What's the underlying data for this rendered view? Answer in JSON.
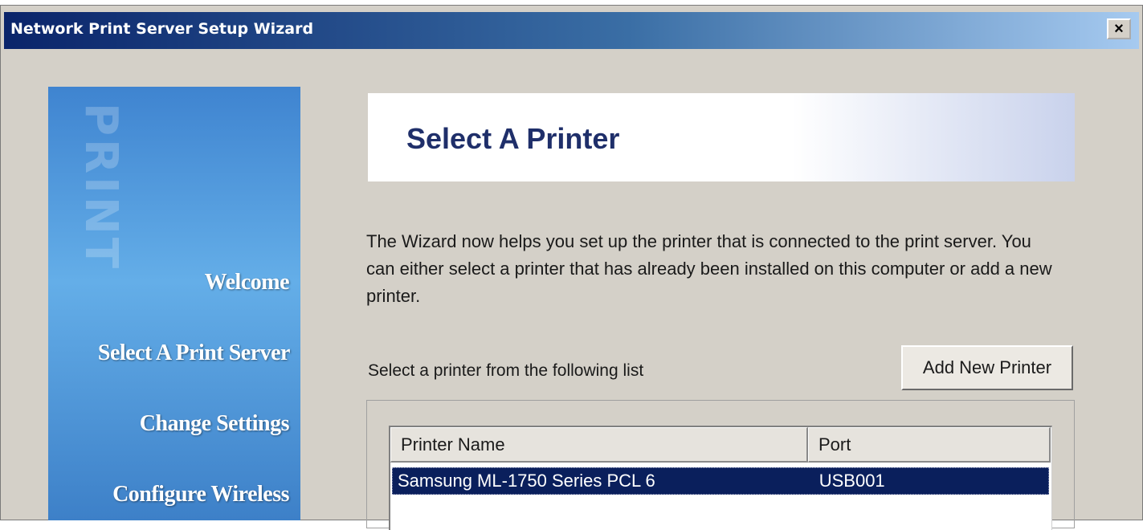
{
  "window": {
    "title": "Network Print Server Setup Wizard",
    "close_glyph": "×"
  },
  "sidebar": {
    "watermark": "PRINT",
    "items": [
      {
        "label": "Welcome"
      },
      {
        "label": "Select A Print Server"
      },
      {
        "label": "Change Settings"
      },
      {
        "label": "Configure Wireless"
      }
    ]
  },
  "header": {
    "title": "Select A Printer"
  },
  "main": {
    "description": "The Wizard now helps you set up the printer that is connected to the print server. You can either select a printer that has already been installed on this computer or add a new printer.",
    "list_label": "Select a printer from the following list",
    "add_button": "Add New Printer",
    "columns": [
      "Printer Name",
      "Port"
    ],
    "rows": [
      {
        "name": "Samsung ML-1750 Series PCL 6",
        "port": "USB001",
        "selected": true
      }
    ]
  },
  "colors": {
    "title_bar_start": "#0a246a",
    "sidebar_blue": "#4a90d9",
    "header_text": "#1f2f6a",
    "selection": "#0a1f5c"
  }
}
